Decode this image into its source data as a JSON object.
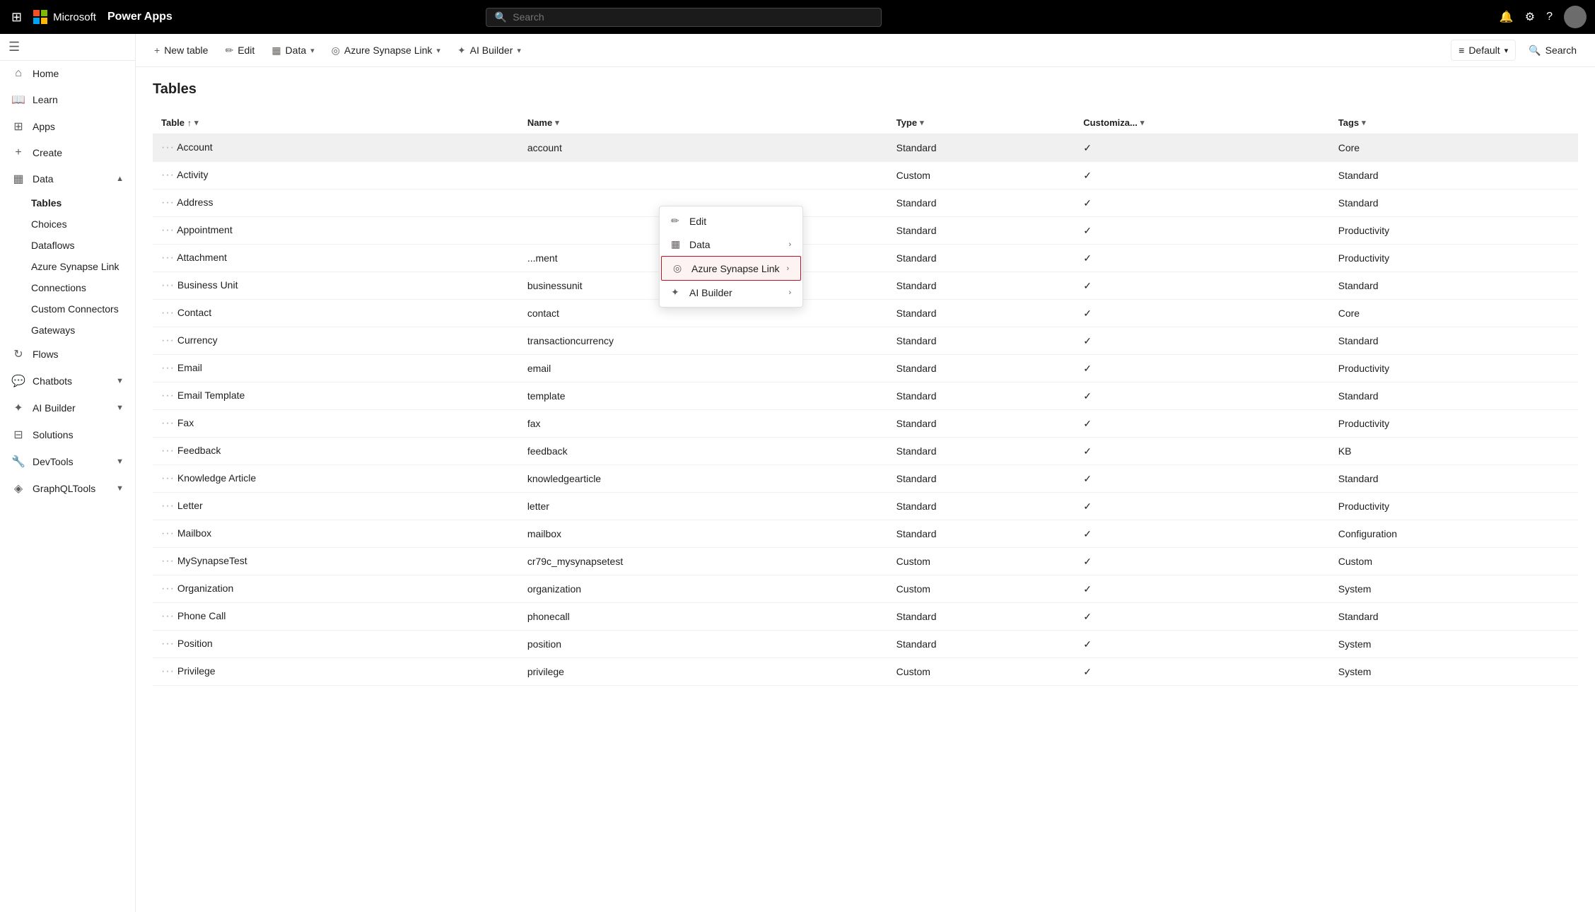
{
  "topbar": {
    "app_name": "Power Apps",
    "search_placeholder": "Search"
  },
  "sidebar": {
    "toggle_icon": "☰",
    "items": [
      {
        "id": "home",
        "label": "Home",
        "icon": "⌂"
      },
      {
        "id": "learn",
        "label": "Learn",
        "icon": "📖"
      },
      {
        "id": "apps",
        "label": "Apps",
        "icon": "⊞"
      },
      {
        "id": "create",
        "label": "Create",
        "icon": "+"
      },
      {
        "id": "data",
        "label": "Data",
        "icon": "▦",
        "expanded": true,
        "chevron": "▲"
      },
      {
        "id": "flows",
        "label": "Flows",
        "icon": "↻"
      },
      {
        "id": "chatbots",
        "label": "Chatbots",
        "icon": "💬",
        "chevron": "▼"
      },
      {
        "id": "ai-builder",
        "label": "AI Builder",
        "icon": "✦",
        "chevron": "▼"
      },
      {
        "id": "solutions",
        "label": "Solutions",
        "icon": "⊟"
      },
      {
        "id": "devtools",
        "label": "DevTools",
        "icon": "🔧",
        "chevron": "▼"
      },
      {
        "id": "graphql",
        "label": "GraphQLTools",
        "icon": "◈",
        "chevron": "▼"
      }
    ],
    "data_subitems": [
      {
        "id": "tables",
        "label": "Tables",
        "active": true
      },
      {
        "id": "choices",
        "label": "Choices"
      },
      {
        "id": "dataflows",
        "label": "Dataflows"
      },
      {
        "id": "azure-synapse",
        "label": "Azure Synapse Link"
      },
      {
        "id": "connections",
        "label": "Connections"
      },
      {
        "id": "custom-connectors",
        "label": "Custom Connectors"
      },
      {
        "id": "gateways",
        "label": "Gateways"
      }
    ]
  },
  "toolbar": {
    "new_table": "New table",
    "edit": "Edit",
    "data": "Data",
    "azure_synapse": "Azure Synapse Link",
    "ai_builder": "AI Builder",
    "default": "Default",
    "search": "Search"
  },
  "page": {
    "title": "Tables",
    "columns": [
      {
        "id": "table",
        "label": "Table",
        "sorted": true
      },
      {
        "id": "name",
        "label": "Name"
      },
      {
        "id": "type",
        "label": "Type"
      },
      {
        "id": "customizable",
        "label": "Customiza..."
      },
      {
        "id": "tags",
        "label": "Tags"
      }
    ],
    "rows": [
      {
        "table": "Account",
        "name": "account",
        "type": "Standard",
        "customizable": true,
        "tags": "Core",
        "selected": true
      },
      {
        "table": "Activity",
        "name": "",
        "type": "Custom",
        "customizable": true,
        "tags": "Standard"
      },
      {
        "table": "Address",
        "name": "",
        "type": "Standard",
        "customizable": true,
        "tags": "Standard"
      },
      {
        "table": "Appointment",
        "name": "",
        "type": "Standard",
        "customizable": true,
        "tags": "Productivity"
      },
      {
        "table": "Attachment",
        "name": "...ment",
        "type": "Standard",
        "customizable": true,
        "tags": "Productivity"
      },
      {
        "table": "Business Unit",
        "name": "businessunit",
        "type": "Standard",
        "customizable": true,
        "tags": "Standard"
      },
      {
        "table": "Contact",
        "name": "contact",
        "type": "Standard",
        "customizable": true,
        "tags": "Core"
      },
      {
        "table": "Currency",
        "name": "transactioncurrency",
        "type": "Standard",
        "customizable": true,
        "tags": "Standard"
      },
      {
        "table": "Email",
        "name": "email",
        "type": "Standard",
        "customizable": true,
        "tags": "Productivity"
      },
      {
        "table": "Email Template",
        "name": "template",
        "type": "Standard",
        "customizable": true,
        "tags": "Standard"
      },
      {
        "table": "Fax",
        "name": "fax",
        "type": "Standard",
        "customizable": true,
        "tags": "Productivity"
      },
      {
        "table": "Feedback",
        "name": "feedback",
        "type": "Standard",
        "customizable": true,
        "tags": "KB"
      },
      {
        "table": "Knowledge Article",
        "name": "knowledgearticle",
        "type": "Standard",
        "customizable": true,
        "tags": "Standard"
      },
      {
        "table": "Letter",
        "name": "letter",
        "type": "Standard",
        "customizable": true,
        "tags": "Productivity"
      },
      {
        "table": "Mailbox",
        "name": "mailbox",
        "type": "Standard",
        "customizable": true,
        "tags": "Configuration"
      },
      {
        "table": "MySynapseTest",
        "name": "cr79c_mysynapsetest",
        "type": "Custom",
        "customizable": true,
        "tags": "Custom"
      },
      {
        "table": "Organization",
        "name": "organization",
        "type": "Custom",
        "customizable": true,
        "tags": "System"
      },
      {
        "table": "Phone Call",
        "name": "phonecall",
        "type": "Standard",
        "customizable": true,
        "tags": "Standard"
      },
      {
        "table": "Position",
        "name": "position",
        "type": "Standard",
        "customizable": true,
        "tags": "System"
      },
      {
        "table": "Privilege",
        "name": "privilege",
        "type": "Custom",
        "customizable": true,
        "tags": "System"
      }
    ]
  },
  "context_menu": {
    "items": [
      {
        "id": "edit",
        "label": "Edit",
        "icon": "✏",
        "has_submenu": false
      },
      {
        "id": "data",
        "label": "Data",
        "icon": "▦",
        "has_submenu": true
      },
      {
        "id": "azure-synapse-link",
        "label": "Azure Synapse Link",
        "icon": "◎",
        "has_submenu": true,
        "highlighted": true
      },
      {
        "id": "ai-builder",
        "label": "AI Builder",
        "icon": "✦",
        "has_submenu": true
      }
    ]
  },
  "icons": {
    "waffle": "⊞",
    "bell": "🔔",
    "gear": "⚙",
    "question": "?",
    "search": "🔍",
    "sort_up": "↑",
    "sort_down": "↓",
    "chevron_down": "▾",
    "chevron_right": "›",
    "ellipsis": "···",
    "checkmark": "✓",
    "lines": "≡"
  }
}
